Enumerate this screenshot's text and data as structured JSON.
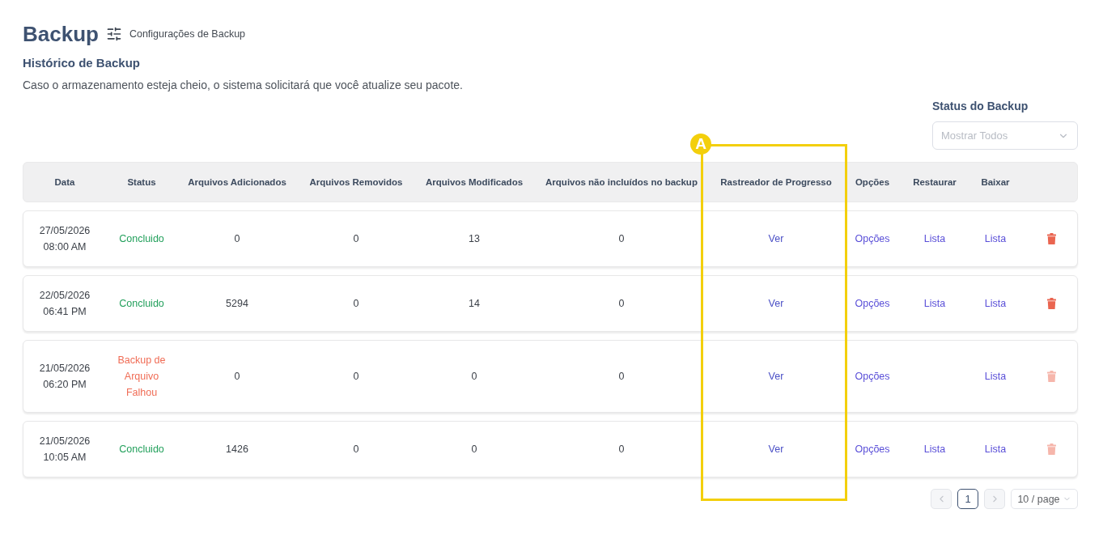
{
  "page": {
    "title": "Backup",
    "settings_link": "Configurações de Backup"
  },
  "history": {
    "heading": "Histórico de Backup",
    "description": "Caso o armazenamento esteja cheio, o sistema solicitará que você atualize seu pacote."
  },
  "status_filter": {
    "label": "Status do Backup",
    "placeholder": "Mostrar Todos"
  },
  "table": {
    "columns": [
      "Data",
      "Status",
      "Arquivos Adicionados",
      "Arquivos Removidos",
      "Arquivos Modificados",
      "Arquivos não incluídos no backup",
      "Rastreador de Progresso",
      "Opções",
      "Restaurar",
      "Baixar"
    ],
    "rows": [
      {
        "datetime": "27/05/2026 08:00 AM",
        "status": "Concluido",
        "failed": false,
        "added": "0",
        "removed": "0",
        "modified": "13",
        "excluded": "0",
        "progress_link": "Ver",
        "options_link": "Opções",
        "restore_link": "Lista",
        "download_link": "Lista",
        "delete_disabled": false
      },
      {
        "datetime": "22/05/2026 06:41 PM",
        "status": "Concluido",
        "failed": false,
        "added": "5294",
        "removed": "0",
        "modified": "14",
        "excluded": "0",
        "progress_link": "Ver",
        "options_link": "Opções",
        "restore_link": "Lista",
        "download_link": "Lista",
        "delete_disabled": false
      },
      {
        "datetime": "21/05/2026 06:20 PM",
        "status": "Backup de Arquivo Falhou",
        "failed": true,
        "added": "0",
        "removed": "0",
        "modified": "0",
        "excluded": "0",
        "progress_link": "Ver",
        "options_link": "Opções",
        "download_link": "Lista",
        "delete_disabled": true
      },
      {
        "datetime": "21/05/2026 10:05 AM",
        "status": "Concluido",
        "failed": false,
        "added": "1426",
        "removed": "0",
        "modified": "0",
        "excluded": "0",
        "progress_link": "Ver",
        "options_link": "Opções",
        "restore_link": "Lista",
        "download_link": "Lista",
        "delete_disabled": true
      }
    ]
  },
  "pagination": {
    "prev_disabled": true,
    "pages": [
      {
        "label": "1",
        "selected": true
      }
    ],
    "next_disabled": true,
    "page_size": "10 / page"
  },
  "annotation": {
    "label": "A"
  }
}
